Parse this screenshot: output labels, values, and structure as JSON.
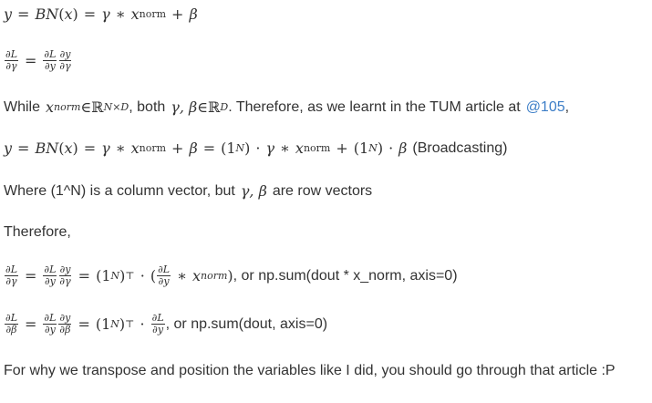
{
  "eq1": {
    "y": "y",
    "bn": "BN",
    "x": "x",
    "gamma": "γ",
    "star": "∗",
    "xnorm_base": "x",
    "xnorm_sub": "norm",
    "plus": "+",
    "beta": "β",
    "eq": "=",
    "lp": "(",
    "rp": ")"
  },
  "eq2": {
    "dL": "∂L",
    "dgamma": "∂γ",
    "dy": "∂y"
  },
  "p1": {
    "while": "While ",
    "x": "x",
    "norm": "norm",
    "in": " ∈ ",
    "R": "ℝ",
    "sup_nd": "N×D",
    "both": ", both ",
    "gb": "γ, β",
    "in2": " ∈ ",
    "sup_d": "D",
    "therefore": ". Therefore, as we learnt in the TUM article at ",
    "link": "@105",
    "end": ","
  },
  "eq3": {
    "oneN": "(1",
    "supN": "N",
    "close": ")",
    "cdot": "·",
    "broadcast": "(Broadcasting)"
  },
  "p2": {
    "text_a": "Where (1^N) is a column vector, but ",
    "gb": "γ, β",
    "text_b": " are row vectors"
  },
  "p3": {
    "text": "Therefore,"
  },
  "eq4": {
    "transpose": "⊤",
    "dbeta": "∂β",
    "norm_it": "norm",
    "tail": ", or np.sum(dout * x_norm, axis=0)"
  },
  "eq5": {
    "tail": ", or np.sum(dout, axis=0)"
  },
  "p4": {
    "text": "For why we transpose and position the variables like I did, you should go through that article :P"
  }
}
